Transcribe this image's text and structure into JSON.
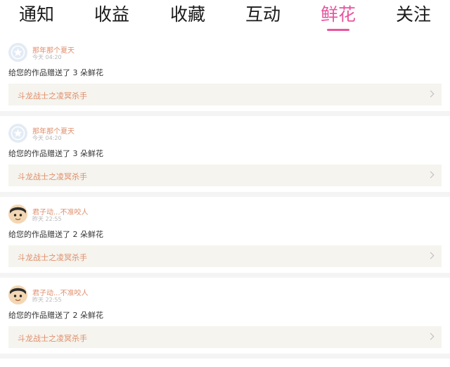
{
  "tabs": [
    {
      "label": "通知",
      "active": false
    },
    {
      "label": "收益",
      "active": false
    },
    {
      "label": "收藏",
      "active": false
    },
    {
      "label": "互动",
      "active": false
    },
    {
      "label": "鲜花",
      "active": true
    },
    {
      "label": "关注",
      "active": false
    }
  ],
  "colors": {
    "accent": "#e8559f",
    "username": "#e08e6b",
    "link_bg": "#f5f4ee"
  },
  "notifications": [
    {
      "avatar": "default-star-avatar",
      "user": "那年那个夏天",
      "time": "今天 04:20",
      "message": "给您的作品赠送了 3 朵鲜花",
      "work": "斗龙战士之凌冥杀手"
    },
    {
      "avatar": "default-star-avatar",
      "user": "那年那个夏天",
      "time": "今天 04:20",
      "message": "给您的作品赠送了 3 朵鲜花",
      "work": "斗龙战士之凌冥杀手"
    },
    {
      "avatar": "cartoon-face-avatar",
      "user": "君子动...不准咬人",
      "time": "昨天 22:55",
      "message": "给您的作品赠送了 2 朵鲜花",
      "work": "斗龙战士之凌冥杀手"
    },
    {
      "avatar": "cartoon-face-avatar",
      "user": "君子动...不准咬人",
      "time": "昨天 22:55",
      "message": "给您的作品赠送了 2 朵鲜花",
      "work": "斗龙战士之凌冥杀手"
    }
  ]
}
